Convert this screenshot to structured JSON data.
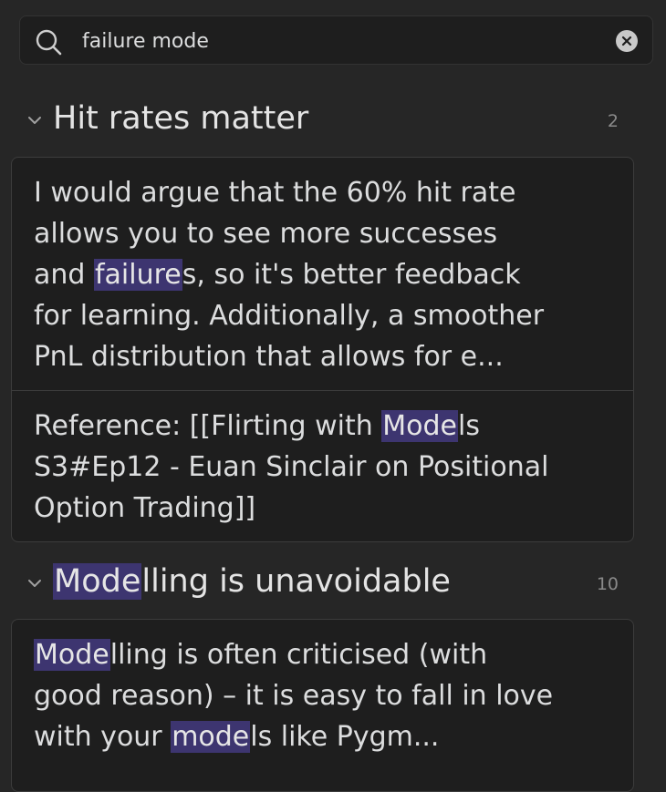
{
  "search": {
    "query": "failure mode"
  },
  "groups": [
    {
      "title": "Hit rates matter",
      "count": "2",
      "snippets": [
        {
          "lines": [
            [
              {
                "t": "I would argue that the 60% hit rate"
              }
            ],
            [
              {
                "t": "allows you to see more successes"
              }
            ],
            [
              {
                "t": "and "
              },
              {
                "t": "failure",
                "hl": true
              },
              {
                "t": "s, so it's better feedback"
              }
            ],
            [
              {
                "t": "for learning. Additionally, a smoother"
              }
            ],
            [
              {
                "t": "PnL distribution that allows for e..."
              }
            ]
          ]
        },
        {
          "lines": [
            [
              {
                "t": "Reference: [[Flirting with "
              },
              {
                "t": "Mode",
                "hl": true
              },
              {
                "t": "ls"
              }
            ],
            [
              {
                "t": "S3#Ep12 - Euan Sinclair on Positional"
              }
            ],
            [
              {
                "t": "Option Trading]]"
              }
            ]
          ]
        }
      ]
    },
    {
      "title_parts": [
        {
          "t": "Mode",
          "hl": true
        },
        {
          "t": "lling is unavoidable"
        }
      ],
      "count": "10",
      "snippets": [
        {
          "lines": [
            [
              {
                "t": "Mode",
                "hl": true
              },
              {
                "t": "lling is often criticised (with"
              }
            ],
            [
              {
                "t": "good reason) – it is easy to fall in love"
              }
            ],
            [
              {
                "t": "with your "
              },
              {
                "t": "mode",
                "hl": true
              },
              {
                "t": "ls like Pygm..."
              }
            ]
          ]
        }
      ]
    }
  ],
  "colors": {
    "background": "#262626",
    "card": "#1e1e1e",
    "highlight": "#3d3570",
    "muted": "#8a8a8a"
  },
  "icons": [
    "search-icon",
    "clear-icon",
    "chevron-down-icon"
  ]
}
